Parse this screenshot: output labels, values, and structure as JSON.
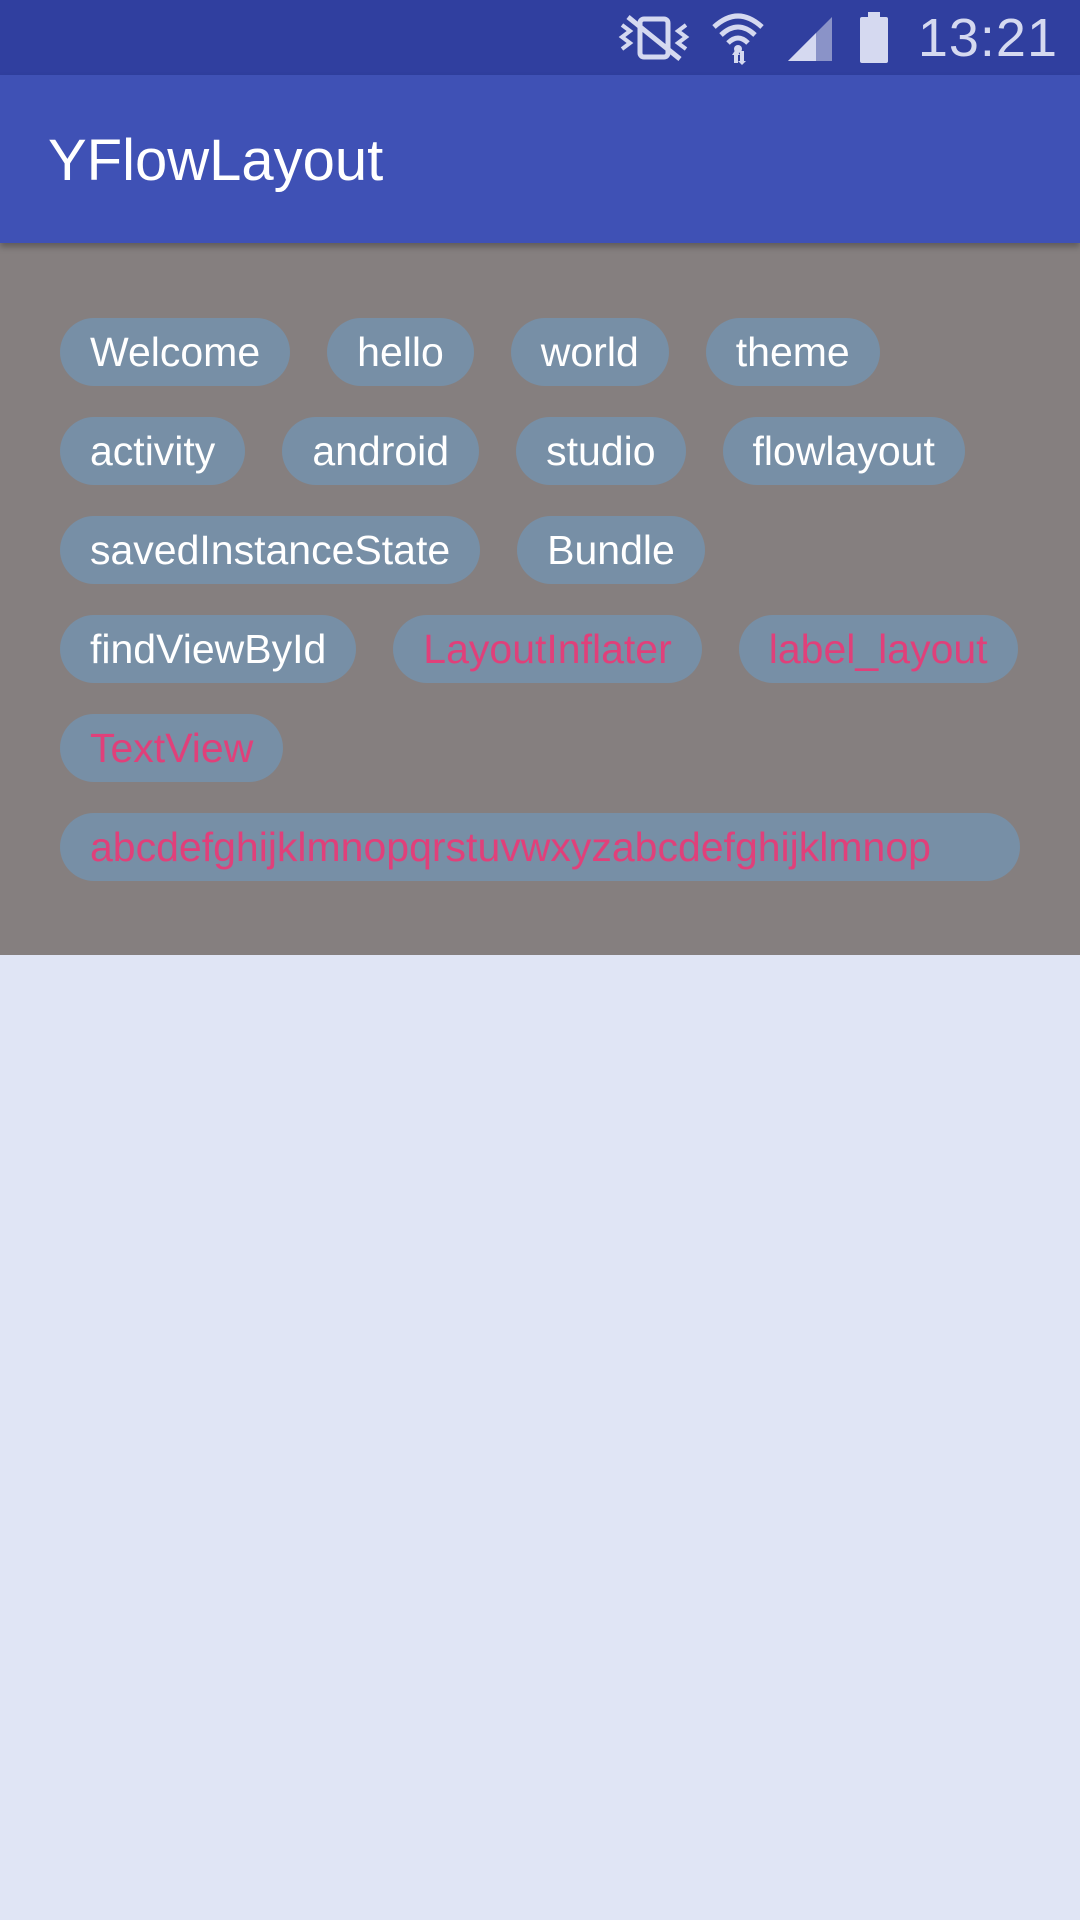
{
  "status_bar": {
    "time": "13:21",
    "icons": [
      "mute-vibrate-icon",
      "wifi-icon",
      "cell-signal-icon",
      "battery-icon"
    ]
  },
  "app_bar": {
    "title": "YFlowLayout"
  },
  "colors": {
    "status_bar": "#303f9f",
    "app_bar": "#3f51b5",
    "panel": "#857f7f",
    "tag_bg": "#778fa6",
    "tag_text": "#ffffff",
    "tag_text_highlight": "#e0407a",
    "page_bg": "#e0e5f5"
  },
  "tags": [
    {
      "label": "Welcome",
      "highlight": false
    },
    {
      "label": "hello",
      "highlight": false
    },
    {
      "label": "world",
      "highlight": false
    },
    {
      "label": "theme",
      "highlight": false
    },
    {
      "label": "activity",
      "highlight": false
    },
    {
      "label": "android",
      "highlight": false
    },
    {
      "label": "studio",
      "highlight": false
    },
    {
      "label": "flowlayout",
      "highlight": false
    },
    {
      "label": "savedInstanceState",
      "highlight": false
    },
    {
      "label": "Bundle",
      "highlight": false
    },
    {
      "label": "findViewById",
      "highlight": false
    },
    {
      "label": "LayoutInflater",
      "highlight": true
    },
    {
      "label": "label_layout",
      "highlight": true
    },
    {
      "label": "TextView",
      "highlight": true
    },
    {
      "label": "abcdefghijklmnopqrstuvwxyzabcdefghijklmnop",
      "highlight": true
    }
  ]
}
